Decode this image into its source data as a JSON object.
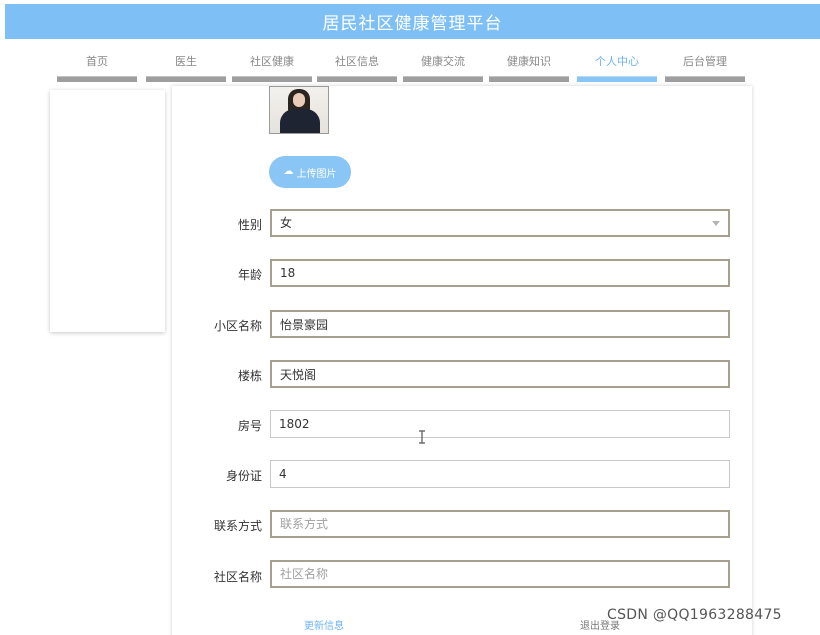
{
  "header": {
    "title": "居民社区健康管理平台"
  },
  "nav": {
    "items": [
      {
        "label": "首页"
      },
      {
        "label": "医生"
      },
      {
        "label": "社区健康"
      },
      {
        "label": "社区信息"
      },
      {
        "label": "健康交流"
      },
      {
        "label": "健康知识"
      },
      {
        "label": "个人中心",
        "active": true
      },
      {
        "label": "后台管理"
      }
    ]
  },
  "profile": {
    "avatar_icon": "avatar-photo",
    "upload_label": "上传图片",
    "upload_icon": "cloud-upload-icon",
    "fields": {
      "gender": {
        "label": "性别",
        "value": "女"
      },
      "age": {
        "label": "年龄",
        "value": "18"
      },
      "community": {
        "label": "小区名称",
        "value": "怡景豪园"
      },
      "building": {
        "label": "楼栋",
        "value": "天悦阁"
      },
      "room": {
        "label": "房号",
        "value": "1802"
      },
      "id_card": {
        "label": "身份证",
        "value": "4"
      },
      "contact": {
        "label": "联系方式",
        "value": "",
        "placeholder": "联系方式"
      },
      "district": {
        "label": "社区名称",
        "value": "",
        "placeholder": "社区名称"
      }
    }
  },
  "actions": {
    "update_label": "更新信息",
    "logout_label": "退出登录"
  },
  "watermark": {
    "text": "CSDN @QQ1963288475"
  },
  "colors": {
    "accent": "#7ec0f5",
    "nav_active": "#8ac6f5",
    "nav_inactive": "#9e9e9e",
    "field_border": "#a6a08f"
  }
}
